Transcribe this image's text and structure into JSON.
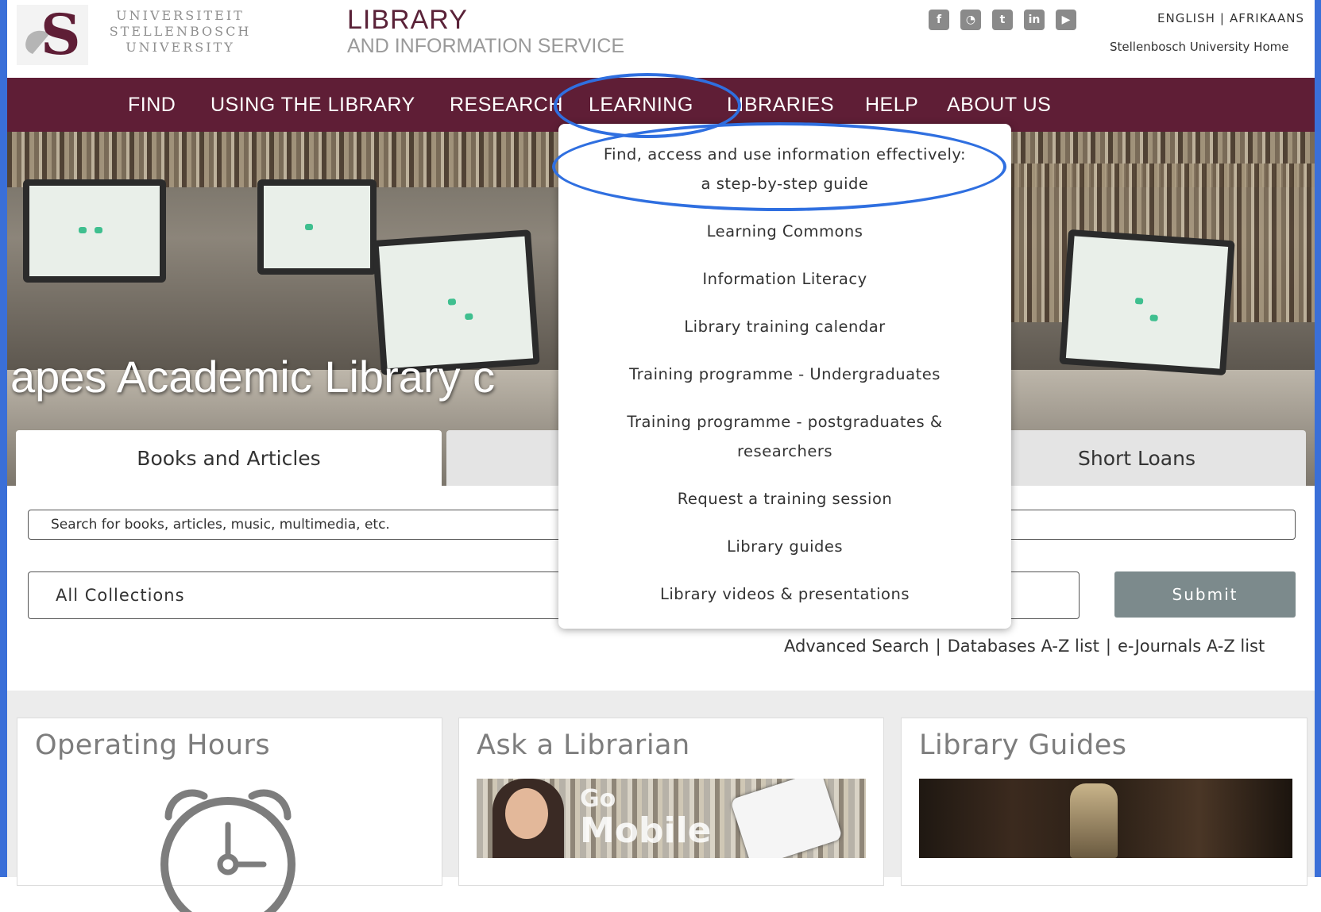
{
  "header": {
    "logo_line1": "UNIVERSITEIT",
    "logo_line2": "STELLENBOSCH",
    "logo_line3": "UNIVERSITY",
    "title": "LIBRARY",
    "subtitle": "AND INFORMATION SERVICE",
    "lang_english": "ENGLISH",
    "lang_sep": "|",
    "lang_afrikaans": "AFRIKAANS",
    "su_home": "Stellenbosch University Home"
  },
  "social": [
    {
      "icon": "facebook-icon",
      "glyph": "f"
    },
    {
      "icon": "rss-icon",
      "glyph": "◔"
    },
    {
      "icon": "twitter-icon",
      "glyph": "t"
    },
    {
      "icon": "linkedin-icon",
      "glyph": "in"
    },
    {
      "icon": "youtube-icon",
      "glyph": "▶"
    }
  ],
  "nav": {
    "find": "FIND",
    "using": "USING THE LIBRARY",
    "research": "RESEARCH",
    "learning": "LEARNING",
    "libraries": "LIBRARIES",
    "help": "HELP",
    "about": "ABOUT US"
  },
  "hero": {
    "caption": "apes Academic Library c"
  },
  "tabs": {
    "books": "Books and Articles",
    "short_loans": "Short Loans"
  },
  "search": {
    "placeholder": "Search for books, articles, music, multimedia, etc.",
    "collection": "All Collections",
    "submit": "Submit"
  },
  "links": {
    "advanced": "Advanced Search",
    "databases": "Databases A-Z list",
    "ejournals": "e-Journals A-Z list",
    "sep": "|"
  },
  "panels": {
    "hours": "Operating Hours",
    "ask": "Ask a Librarian",
    "ask_go": "Go",
    "ask_mobile": "Mobile",
    "guides": "Library Guides"
  },
  "dropdown": {
    "items": [
      "Find, access and use information effectively:",
      "a step-by-step guide",
      "Learning Commons",
      "Information Literacy",
      "Library training calendar",
      "Training programme - Undergraduates",
      "Training programme - postgraduates &",
      "researchers",
      "Request a training session",
      "Library guides",
      "Library videos & presentations"
    ]
  },
  "colors": {
    "nav": "#5f1e36",
    "accent_annotation": "#2f6fe0",
    "submit": "#7c8a8c"
  }
}
